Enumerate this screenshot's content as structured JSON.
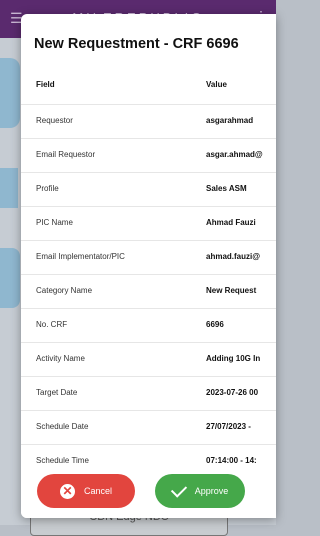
{
  "background": {
    "app_title": "MILEREPUBLIC",
    "bottom_button_label": "CDN Edge NDC"
  },
  "dialog": {
    "title": "New Requestment - CRF 6696",
    "columns": {
      "field": "Field",
      "value": "Value"
    },
    "rows": [
      {
        "field": "Requestor",
        "value": "asgarahmad"
      },
      {
        "field": "Email Requestor",
        "value": "asgar.ahmad@"
      },
      {
        "field": "Profile",
        "value": "Sales ASM"
      },
      {
        "field": "PIC Name",
        "value": "Ahmad Fauzi"
      },
      {
        "field": "Email Implementator/PIC",
        "value": "ahmad.fauzi@"
      },
      {
        "field": "Category Name",
        "value": "New Request"
      },
      {
        "field": "No. CRF",
        "value": "6696"
      },
      {
        "field": "Activity Name",
        "value": "Adding 10G In"
      },
      {
        "field": "Target Date",
        "value": "2023-07-26 00"
      },
      {
        "field": "Schedule Date",
        "value": "27/07/2023 - "
      },
      {
        "field": "Schedule Time",
        "value": "07:14:00 - 14:"
      }
    ],
    "actions": {
      "cancel_label": "Cancel",
      "approve_label": "Approve"
    }
  },
  "colors": {
    "cancel": "#e2453e",
    "approve": "#45a84a",
    "appbar": "#5a2a6e"
  }
}
